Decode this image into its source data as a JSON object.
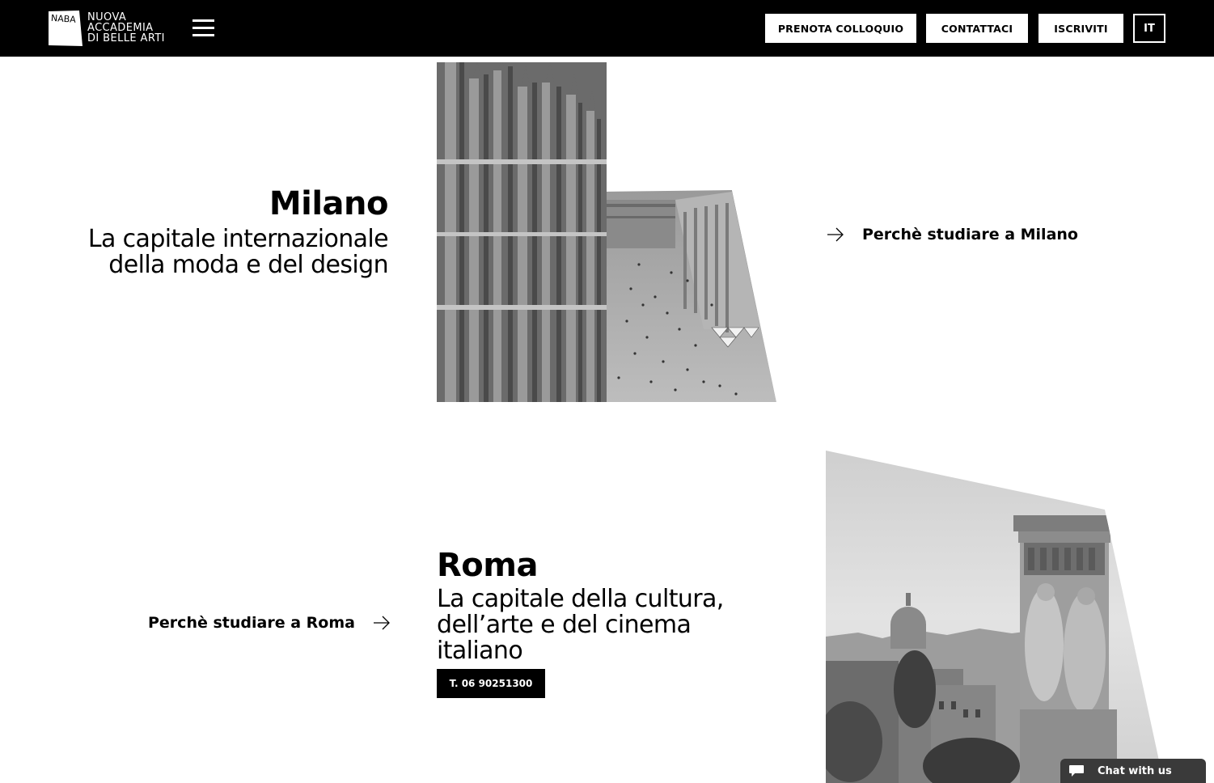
{
  "header": {
    "logo": {
      "mark_text": "NABA",
      "lines": [
        "NUOVA",
        "ACCADEMIA",
        "DI BELLE ARTI"
      ]
    },
    "menu_icon": "hamburger-icon",
    "buttons": {
      "book_interview": "PRENOTA COLLOQUIO",
      "contact": "CONTATTACI",
      "enroll": "ISCRIVITI",
      "language": "IT"
    }
  },
  "milano": {
    "title": "Milano",
    "subtitle_line1": "La capitale internazionale",
    "subtitle_line2": "della moda e del design",
    "link": "Perchè studiare a Milano",
    "image_icon": "milan-cathedral-photo"
  },
  "roma": {
    "title": "Roma",
    "subtitle_line1": "La capitale della cultura,",
    "subtitle_line2": "dell’arte e del cinema",
    "subtitle_line3": "italiano",
    "phone": "T. 06 90251300",
    "link": "Perchè studiare a Roma",
    "image_icon": "rome-skyline-photo"
  },
  "chat": {
    "label": "Chat with us",
    "icon": "speech-bubble-icon"
  },
  "colors": {
    "header_bg": "#000000",
    "page_bg": "#ffffff",
    "chat_bg": "#3a3a3a"
  }
}
